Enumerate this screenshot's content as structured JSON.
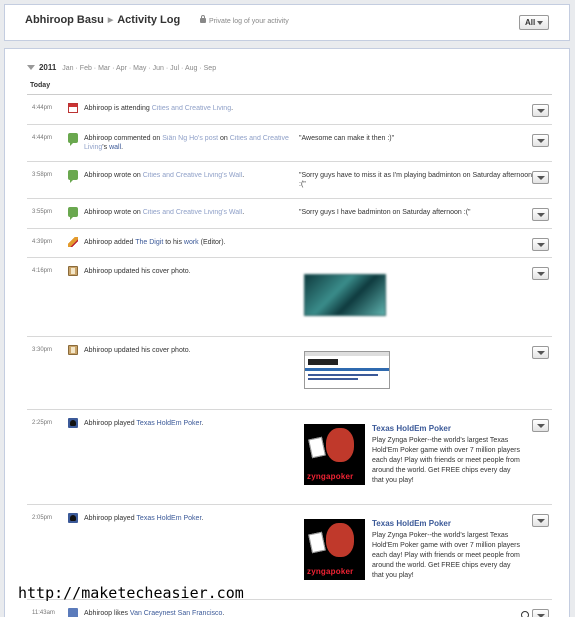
{
  "header": {
    "name": "Abhiroop Basu",
    "page": "Activity Log",
    "privacy": "Private log of your activity",
    "filter": "All"
  },
  "timeline": {
    "year": "2011",
    "months": [
      "Jan",
      "Feb",
      "Mar",
      "Apr",
      "May",
      "Jun",
      "Jul",
      "Aug",
      "Sep"
    ],
    "section": "Today"
  },
  "entries": [
    {
      "time": "4:44pm",
      "icon": "calendar-icon",
      "t1": "Abhiroop is attending ",
      "l1": "Cities and Creative Living",
      "t2": "."
    },
    {
      "time": "4:44pm",
      "icon": "comment-icon",
      "t1": "Abhiroop commented on ",
      "l1": "Siân Ng Ho's post",
      "t2": " on ",
      "l2": "Cities and Creative Living",
      "t3": "'s ",
      "l3": "wall",
      "t4": ".",
      "quote": "\"Awesome can make it then :)\""
    },
    {
      "time": "3:58pm",
      "icon": "comment-icon",
      "t1": "Abhiroop wrote on ",
      "l1": "Cities and Creative Living's Wall",
      "t2": ".",
      "quote": "\"Sorry guys have to miss it as I'm playing badminton on Saturday afternoon :(\""
    },
    {
      "time": "3:55pm",
      "icon": "comment-icon",
      "t1": "Abhiroop wrote on ",
      "l1": "Cities and Creative Living's Wall",
      "t2": ".",
      "quote": "\"Sorry guys I have badminton on Saturday afternoon :(\""
    },
    {
      "time": "4:39pm",
      "icon": "pencil-icon",
      "t1": "Abhiroop added ",
      "l1": "The Digit",
      "t2": " to his ",
      "l2": "work",
      "t3": " (Editor)."
    },
    {
      "time": "4:16pm",
      "icon": "photo-book-icon",
      "t1": "Abhiroop updated his cover photo."
    },
    {
      "time": "3:30pm",
      "icon": "photo-book-icon",
      "t1": "Abhiroop updated his cover photo."
    },
    {
      "time": "2:25pm",
      "icon": "game-icon",
      "t1": "Abhiroop played ",
      "l1": "Texas HoldEm Poker",
      "t2": ".",
      "game_title": "Texas HoldEm Poker",
      "game_desc": "Play Zynga Poker--the world's largest Texas Hold'Em Poker game with over 7 million players each day! Play with friends or meet people from around the world. Get FREE chips every day that you play!",
      "game_logo": "zyngapoker"
    },
    {
      "time": "2:05pm",
      "icon": "game-icon",
      "t1": "Abhiroop played ",
      "l1": "Texas HoldEm Poker",
      "t2": ".",
      "game_title": "Texas HoldEm Poker",
      "game_desc": "Play Zynga Poker--the world's largest Texas Hold'Em Poker game with over 7 million players each day! Play with friends or meet people from around the world. Get FREE chips every day that you play!",
      "game_logo": "zyngapoker"
    },
    {
      "time": "11:43am",
      "icon": "like-icon",
      "t1": "Abhiroop likes ",
      "l1": "Van Craeynest San Francisco",
      "t2": "."
    }
  ],
  "watermark": "http://maketecheasier.com",
  "colors": {
    "link": "#3b5998",
    "border": "#c4cde0",
    "background": "#e9ebee"
  }
}
